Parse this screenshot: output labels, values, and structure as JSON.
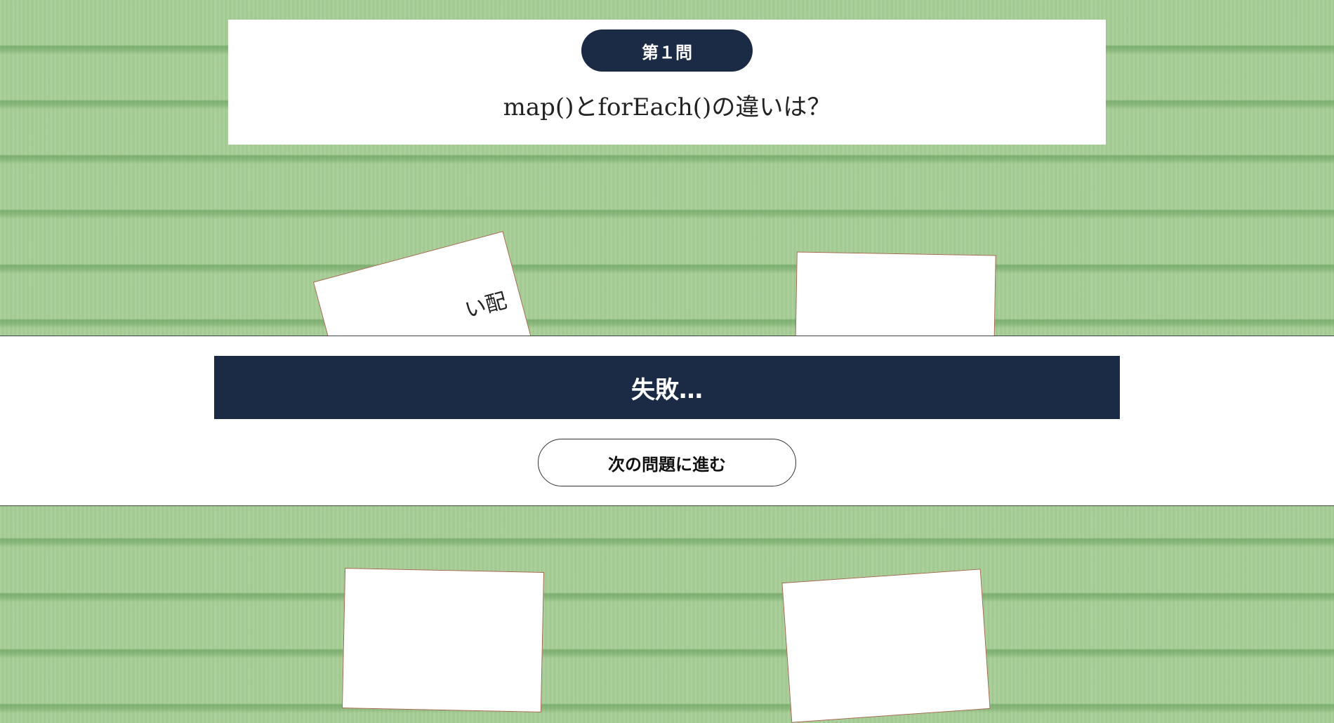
{
  "question": {
    "number_label": "第１問",
    "text": "map()とforEach()の違いは？"
  },
  "cards": [
    {
      "text": "い配"
    },
    {
      "text": ""
    },
    {
      "text": ""
    },
    {
      "text": ""
    }
  ],
  "result": {
    "message": "失敗…",
    "next_button_label": "次の問題に進む"
  },
  "colors": {
    "background_tatami": "#a3cb92",
    "navy": "#1b2a45",
    "card_border": "#a0684b"
  }
}
